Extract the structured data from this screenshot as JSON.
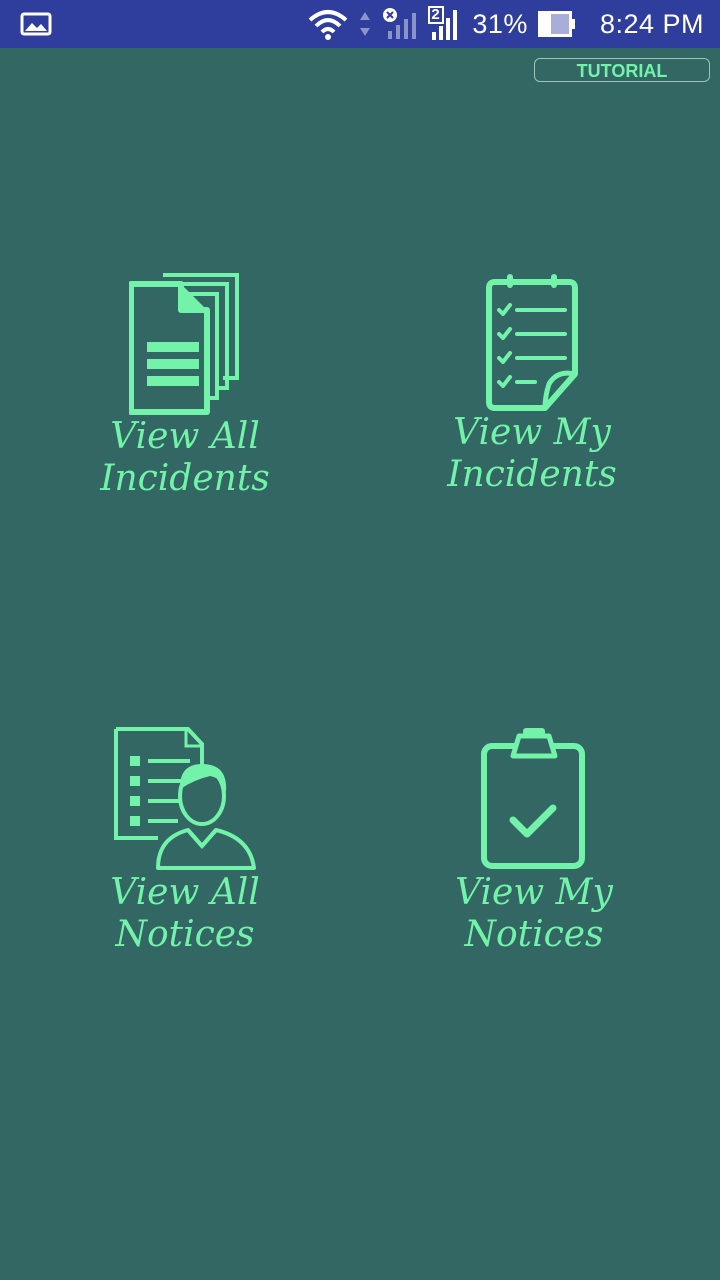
{
  "status_bar": {
    "battery_text": "31%",
    "time": "8:24 PM",
    "sim_number": "2",
    "icons": [
      "gallery-icon",
      "wifi-icon",
      "data-arrows-icon",
      "signal-off-icon",
      "signal-icon",
      "battery-icon"
    ]
  },
  "header": {
    "tutorial_label": "TUTORIAL"
  },
  "tiles": {
    "view_all_incidents": {
      "line1": "View All",
      "line2": "Incidents",
      "icon": "documents-stack-icon"
    },
    "view_my_incidents": {
      "line1": "View My",
      "line2": "Incidents",
      "icon": "checklist-icon"
    },
    "view_all_notices": {
      "label": "View All Notices",
      "icon": "user-document-icon"
    },
    "view_my_notices": {
      "label": "View My Notices",
      "icon": "clipboard-check-icon"
    }
  },
  "colors": {
    "background": "#326764",
    "status_bar": "#2f3e9c",
    "accent": "#72f3a9"
  }
}
